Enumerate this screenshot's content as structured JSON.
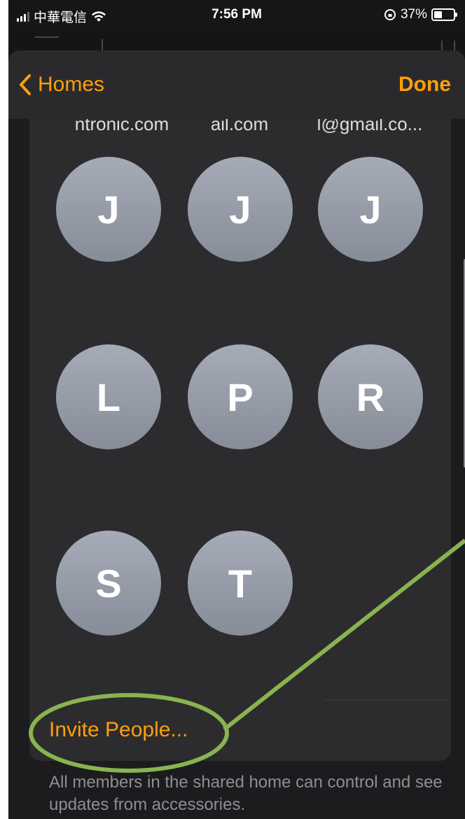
{
  "status_bar": {
    "carrier": "中華電信",
    "time": "7:56 PM",
    "battery_percent": "37%",
    "battery_level": 0.37,
    "icons": [
      "signal-icon",
      "wifi-icon",
      "orientation-lock-icon",
      "battery-icon"
    ]
  },
  "nav": {
    "back_label": "Homes",
    "done_label": "Done"
  },
  "members": {
    "emails": [
      "ntronic.com",
      "ail.com",
      "l@gmail.co..."
    ],
    "avatars": [
      "J",
      "J",
      "J",
      "L",
      "P",
      "R",
      "S",
      "T"
    ]
  },
  "invite_label": "Invite People...",
  "footer_text": "All members in the shared home can control and see updates from accessories.",
  "colors": {
    "accent": "#ff9f0a",
    "annotation": "#8ab34f",
    "avatar": "#9a9fac"
  }
}
